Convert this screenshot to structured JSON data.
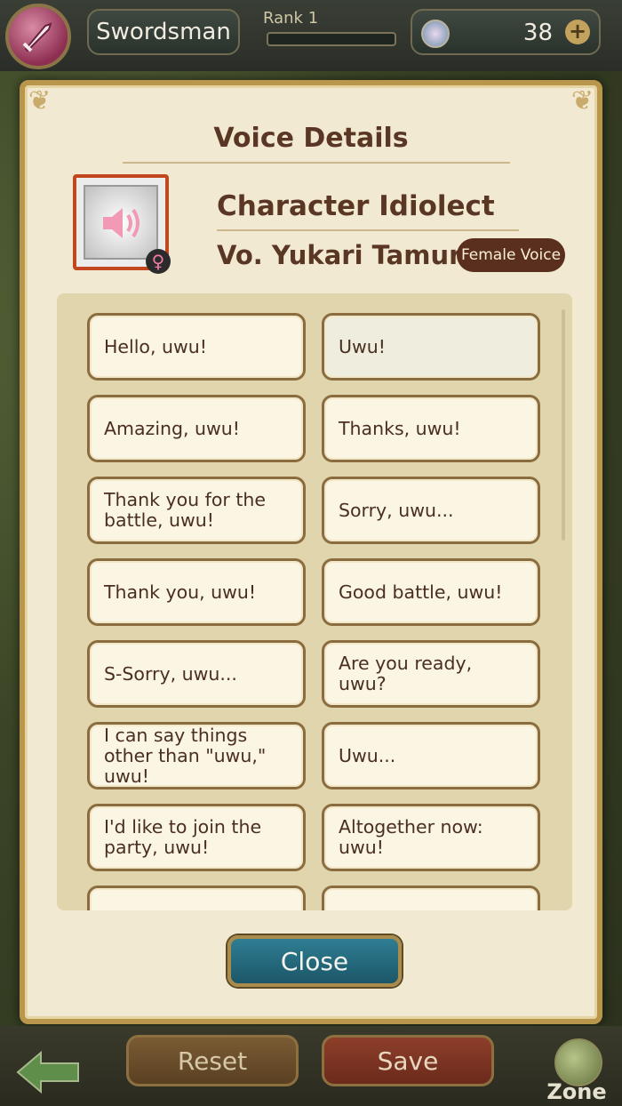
{
  "header": {
    "class_name": "Swordsman",
    "rank_label": "Rank 1",
    "rank_progress": 0.0,
    "currency_count": "38"
  },
  "dialog": {
    "title": "Voice Details",
    "voice_name": "Character Idiolect",
    "voice_actor": "Vo. Yukari Tamura",
    "voice_type_badge": "Female Voice",
    "gender_symbol": "♀",
    "lines": [
      "Hello, uwu!",
      "Uwu!",
      "Amazing, uwu!",
      "Thanks, uwu!",
      "Thank you for the battle, uwu!",
      "Sorry, uwu...",
      "Thank you, uwu!",
      "Good battle, uwu!",
      "S-Sorry, uwu...",
      "Are you ready, uwu?",
      "I can say things other than \"uwu,\" uwu!",
      "Uwu...",
      "I'd like to join the party, uwu!",
      "Altogether now: uwu!",
      "",
      ""
    ],
    "close_label": "Close"
  },
  "footer": {
    "reset_label": "Reset",
    "save_label": "Save",
    "zone_label": "Zone"
  },
  "colors": {
    "dialog_bg": "#f2e9d2",
    "title_text": "#5a3724",
    "close_button": "#2f7e93",
    "badge_bg": "#5b2f1e"
  },
  "icons": [
    "sword-class-icon",
    "gem-icon",
    "plus-icon",
    "speaker-icon",
    "female-icon",
    "back-arrow-icon",
    "globe-icon"
  ]
}
